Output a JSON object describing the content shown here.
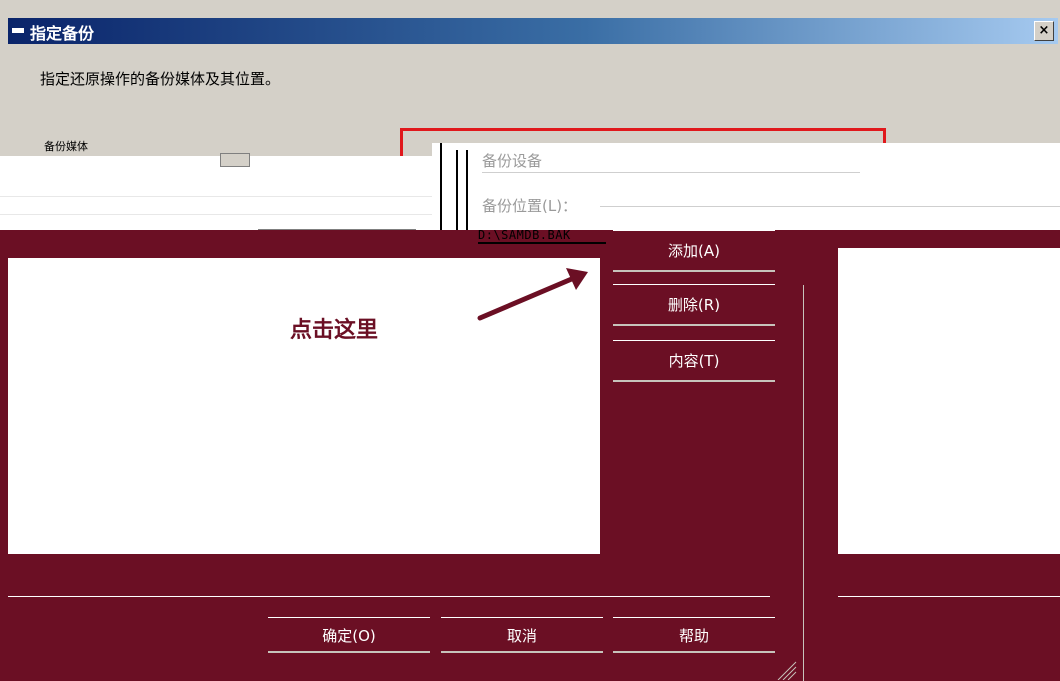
{
  "window": {
    "title": "指定备份",
    "close_glyph": "×",
    "icon": "window-icon"
  },
  "instruction": "指定还原操作的备份媒体及其位置。",
  "backup_media": {
    "label": "备份媒体",
    "device_type": "备份设备",
    "location_label": "备份位置(L)：",
    "path": "D:\\SAMDB.BAK"
  },
  "buttons": {
    "add": "添加(A)",
    "remove": "删除(R)",
    "contents": "内容(T)",
    "ok": "确定(O)",
    "cancel": "取消",
    "help": "帮助"
  },
  "annotation": {
    "text": "点击这里",
    "color": "#6b0f24"
  },
  "colors": {
    "dialog_bg": "#d4d0c8",
    "title_start": "#0a246a",
    "title_end": "#a6caf0",
    "highlight_frame": "#e0181c",
    "overlay": "#6b0f24"
  }
}
